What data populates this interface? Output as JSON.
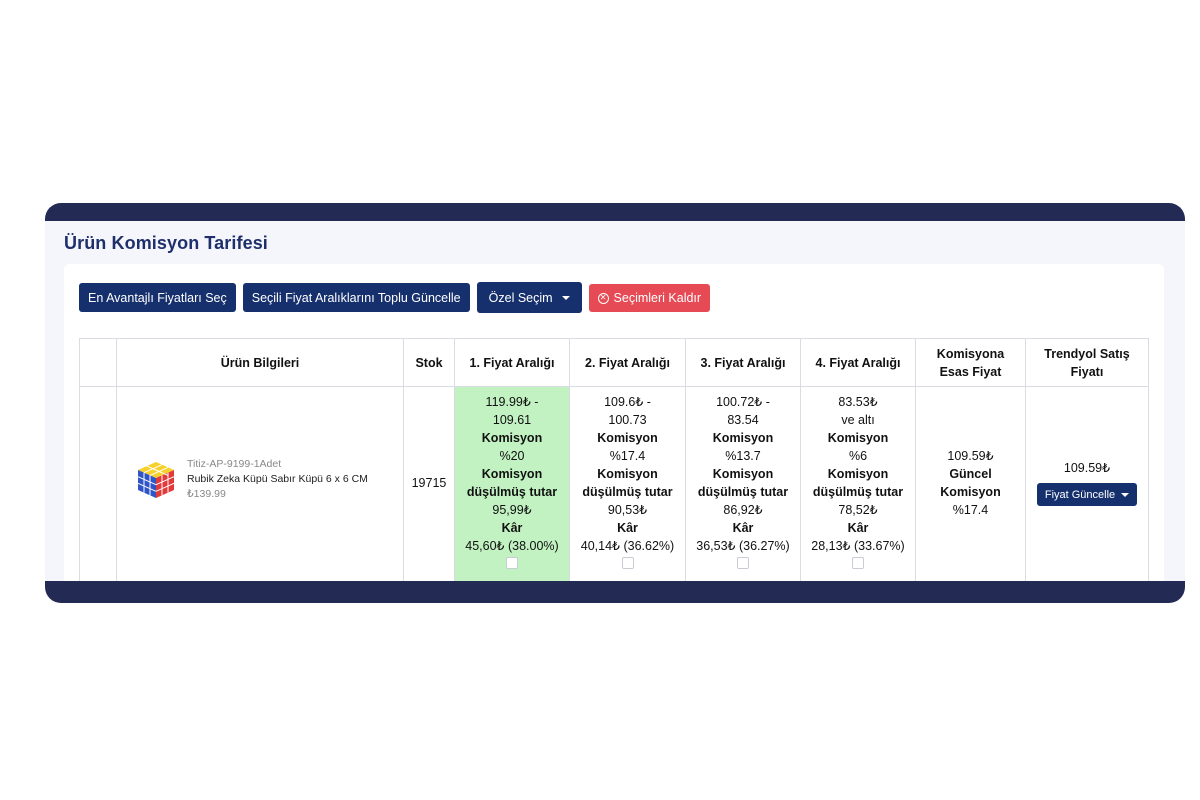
{
  "page": {
    "title": "Ürün Komisyon Tarifesi"
  },
  "toolbar": {
    "best_prices": "En Avantajlı Fiyatları Seç",
    "bulk_update": "Seçili Fiyat Aralıklarını Toplu Güncelle",
    "custom_select": "Özel Seçim",
    "clear_selection": "Seçimleri Kaldır"
  },
  "table": {
    "headers": {
      "product": "Ürün Bilgileri",
      "stock": "Stok",
      "range1": "1. Fiyat Aralığı",
      "range2": "2. Fiyat Aralığı",
      "range3": "3. Fiyat Aralığı",
      "range4": "4. Fiyat Aralığı",
      "commission_base_1": "Komisyona",
      "commission_base_2": "Esas Fiyat",
      "sale_price_1": "Trendyol Satış",
      "sale_price_2": "Fiyatı"
    },
    "row": {
      "product_code": "Titiz-AP-9199-1Adet",
      "product_name": "Rubik Zeka Küpü Sabır Küpü 6 x 6 CM",
      "product_price": "₺139.99",
      "stock": "19715",
      "ranges": [
        {
          "line1": "119.99₺ -",
          "line2": "109.61",
          "commission_label": "Komisyon",
          "commission": "%20",
          "net_label_1": "Komisyon",
          "net_label_2": "düşülmüş tutar",
          "net": "95,99₺",
          "profit_label": "Kâr",
          "profit": "45,60₺ (38.00%)",
          "selected": true
        },
        {
          "line1": "109.6₺ -",
          "line2": "100.73",
          "commission_label": "Komisyon",
          "commission": "%17.4",
          "net_label_1": "Komisyon",
          "net_label_2": "düşülmüş tutar",
          "net": "90,53₺",
          "profit_label": "Kâr",
          "profit": "40,14₺ (36.62%)",
          "selected": false
        },
        {
          "line1": "100.72₺ -",
          "line2": "83.54",
          "commission_label": "Komisyon",
          "commission": "%13.7",
          "net_label_1": "Komisyon",
          "net_label_2": "düşülmüş tutar",
          "net": "86,92₺",
          "profit_label": "Kâr",
          "profit": "36,53₺ (36.27%)",
          "selected": false
        },
        {
          "line1": "83.53₺",
          "line2": "ve altı",
          "commission_label": "Komisyon",
          "commission": "%6",
          "net_label_1": "Komisyon",
          "net_label_2": "düşülmüş tutar",
          "net": "78,52₺",
          "profit_label": "Kâr",
          "profit": "28,13₺ (33.67%)",
          "selected": false
        }
      ],
      "commission_base_price": "109.59₺",
      "current_label": "Güncel",
      "commission_label": "Komisyon",
      "current_commission": "%17.4",
      "sale_price": "109.59₺",
      "update_button": "Fiyat Güncelle"
    }
  },
  "colors": {
    "primary": "#16306e",
    "danger": "#e64a55",
    "selected_cell": "#c2f2c2",
    "frame": "#232b55",
    "title": "#1f2f6b"
  },
  "icons": {
    "dropdown": "caret-down-icon",
    "clear": "x-circle-icon",
    "product_image": "rubik-cube-icon"
  }
}
